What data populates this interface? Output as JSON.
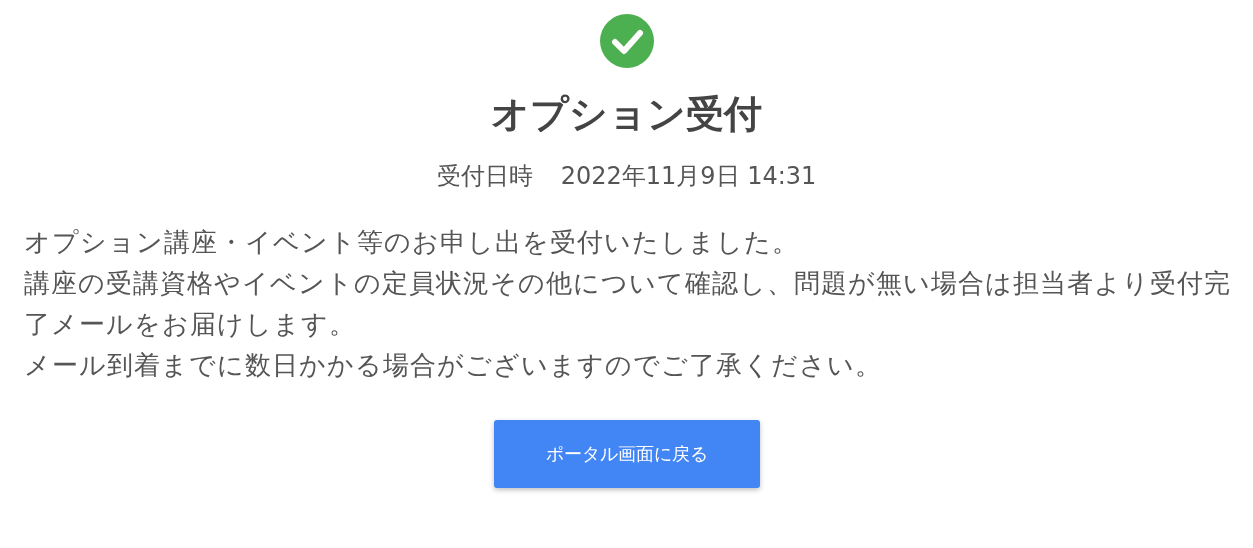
{
  "status": {
    "kind": "success"
  },
  "title": "オプション受付",
  "received": {
    "label": "受付日時",
    "value": "2022年11月9日 14:31"
  },
  "message": [
    "オプション講座・イベント等のお申し出を受付いたしました。",
    "講座の受講資格やイベントの定員状況その他について確認し、問題が無い場合は担当者より受付完了メールをお届けします。",
    "メール到着までに数日かかる場合がございますのでご了承ください。"
  ],
  "button": "ポータル画面に戻る"
}
